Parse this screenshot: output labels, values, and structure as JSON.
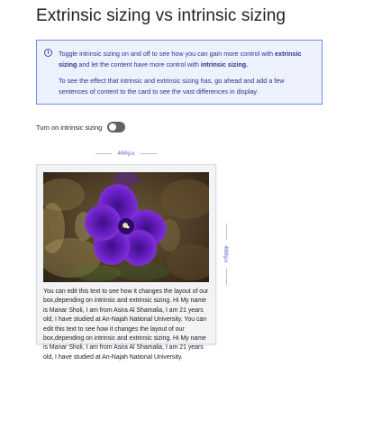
{
  "page": {
    "title": "Extrinsic sizing vs intrinsic sizing"
  },
  "info": {
    "icon": "info-circle-icon",
    "p1_a": "Toggle intrinsic sizing on and off to see how you can gain more control with ",
    "p1_b": "extrinsic sizing",
    "p1_c": " and let the content have more control with ",
    "p1_d": "intrinsic sizing.",
    "p2": "To see the effect that intrinsic and extrinsic sizing has, go ahead and add a few sentences of content to the card to see the vast differences in display."
  },
  "toggle": {
    "label": "Turn on intrinsic sizing",
    "checked": false
  },
  "measure": {
    "width_label": "400px",
    "height_label": "400px"
  },
  "card": {
    "image": "purple-flower-photo",
    "text": "You can edit this text to see how it changes the layout of our box,depending on intrinsic and extrinsic sizing. Hi My name is Manar Sholi, I am from Asira Al Shamalia, I am 21 years old, I have studied at An-Najah National University. You can edit this text to see how it changes the layout of our box,depending on intrinsic and extrinsic sizing. Hi My name is Manar Sholi, I am from Asira Al Shamalia, I am 21 years old, I have studied at An-Najah National University."
  },
  "colors": {
    "info_border": "#6f8fe8",
    "info_background": "#eef2fe",
    "info_text": "#2a3486",
    "measure_label": "#5c6ec9",
    "toggle_track": "#5f6368"
  }
}
